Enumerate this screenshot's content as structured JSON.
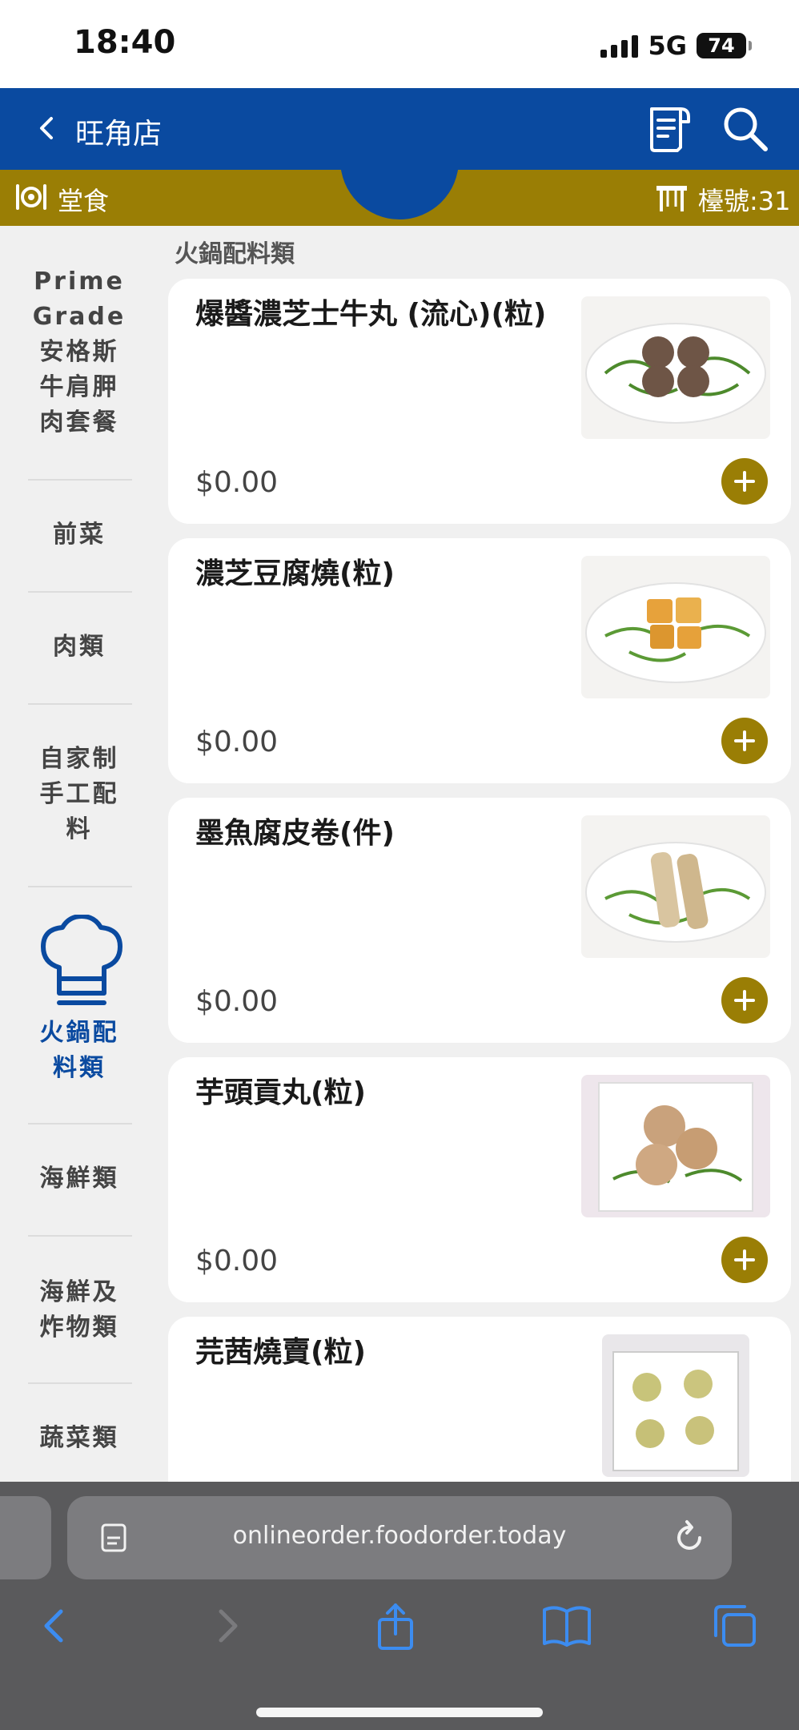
{
  "status": {
    "time": "18:40",
    "network": "5G",
    "battery": "74"
  },
  "header": {
    "store_name": "旺角店"
  },
  "dine_bar": {
    "mode_label": "堂食",
    "table_label": "檯號:31"
  },
  "category_title": "火鍋配料類",
  "sidebar": {
    "items": [
      {
        "label": "Prime Grade 安格斯 牛肩胛 肉套餐"
      },
      {
        "label": "前菜"
      },
      {
        "label": "肉類"
      },
      {
        "label": "自家制 手工配 料"
      },
      {
        "label": "火鍋配 料類",
        "active": true,
        "icon": "chef-hat-icon"
      },
      {
        "label": "海鮮類"
      },
      {
        "label": "海鮮及 炸物類"
      },
      {
        "label": "蔬菜類"
      }
    ]
  },
  "menu_items": [
    {
      "name": "爆醬濃芝士牛丸 (流心)(粒)",
      "price": "$0.00",
      "image": "beef-balls-plate"
    },
    {
      "name": "濃芝豆腐燒(粒)",
      "price": "$0.00",
      "image": "tofu-plate"
    },
    {
      "name": "墨魚腐皮卷(件)",
      "price": "$0.00",
      "image": "beancurd-rolls-plate"
    },
    {
      "name": "芋頭貢丸(粒)",
      "price": "$0.00",
      "image": "taro-balls-plate"
    },
    {
      "name": "芫茜燒賣(粒)",
      "price": "",
      "image": "siu-mai-plate"
    }
  ],
  "browser": {
    "url": "onlineorder.foodorder.today"
  },
  "colors": {
    "brand_blue": "#0a4aa0",
    "gold": "#9a7e05",
    "browser_gray": "#5a5a5c",
    "ios_blue": "#3c8cf0"
  }
}
